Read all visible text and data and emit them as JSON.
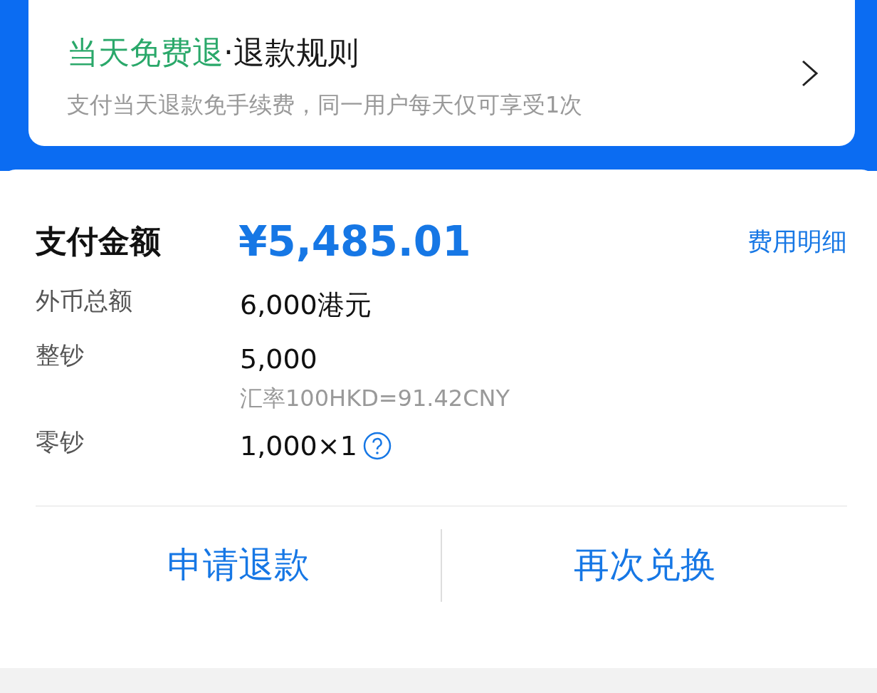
{
  "refund_card": {
    "highlight": "当天免费退",
    "title": "·退款规则",
    "description": "支付当天退款免手续费，同一用户每天仅可享受1次"
  },
  "payment": {
    "label": "支付金额",
    "amount": "¥5,485.01",
    "detail_link": "费用明细"
  },
  "rows": [
    {
      "label": "外币总额",
      "value": "6,000港元",
      "has_info": false
    },
    {
      "label": "整钞",
      "value": "5,000",
      "note": "汇率100HKD=91.42CNY",
      "has_info": false
    },
    {
      "label": "零钞",
      "value": "1,000×1",
      "has_info": true
    }
  ],
  "actions": [
    "申请退款",
    "再次兑换"
  ]
}
